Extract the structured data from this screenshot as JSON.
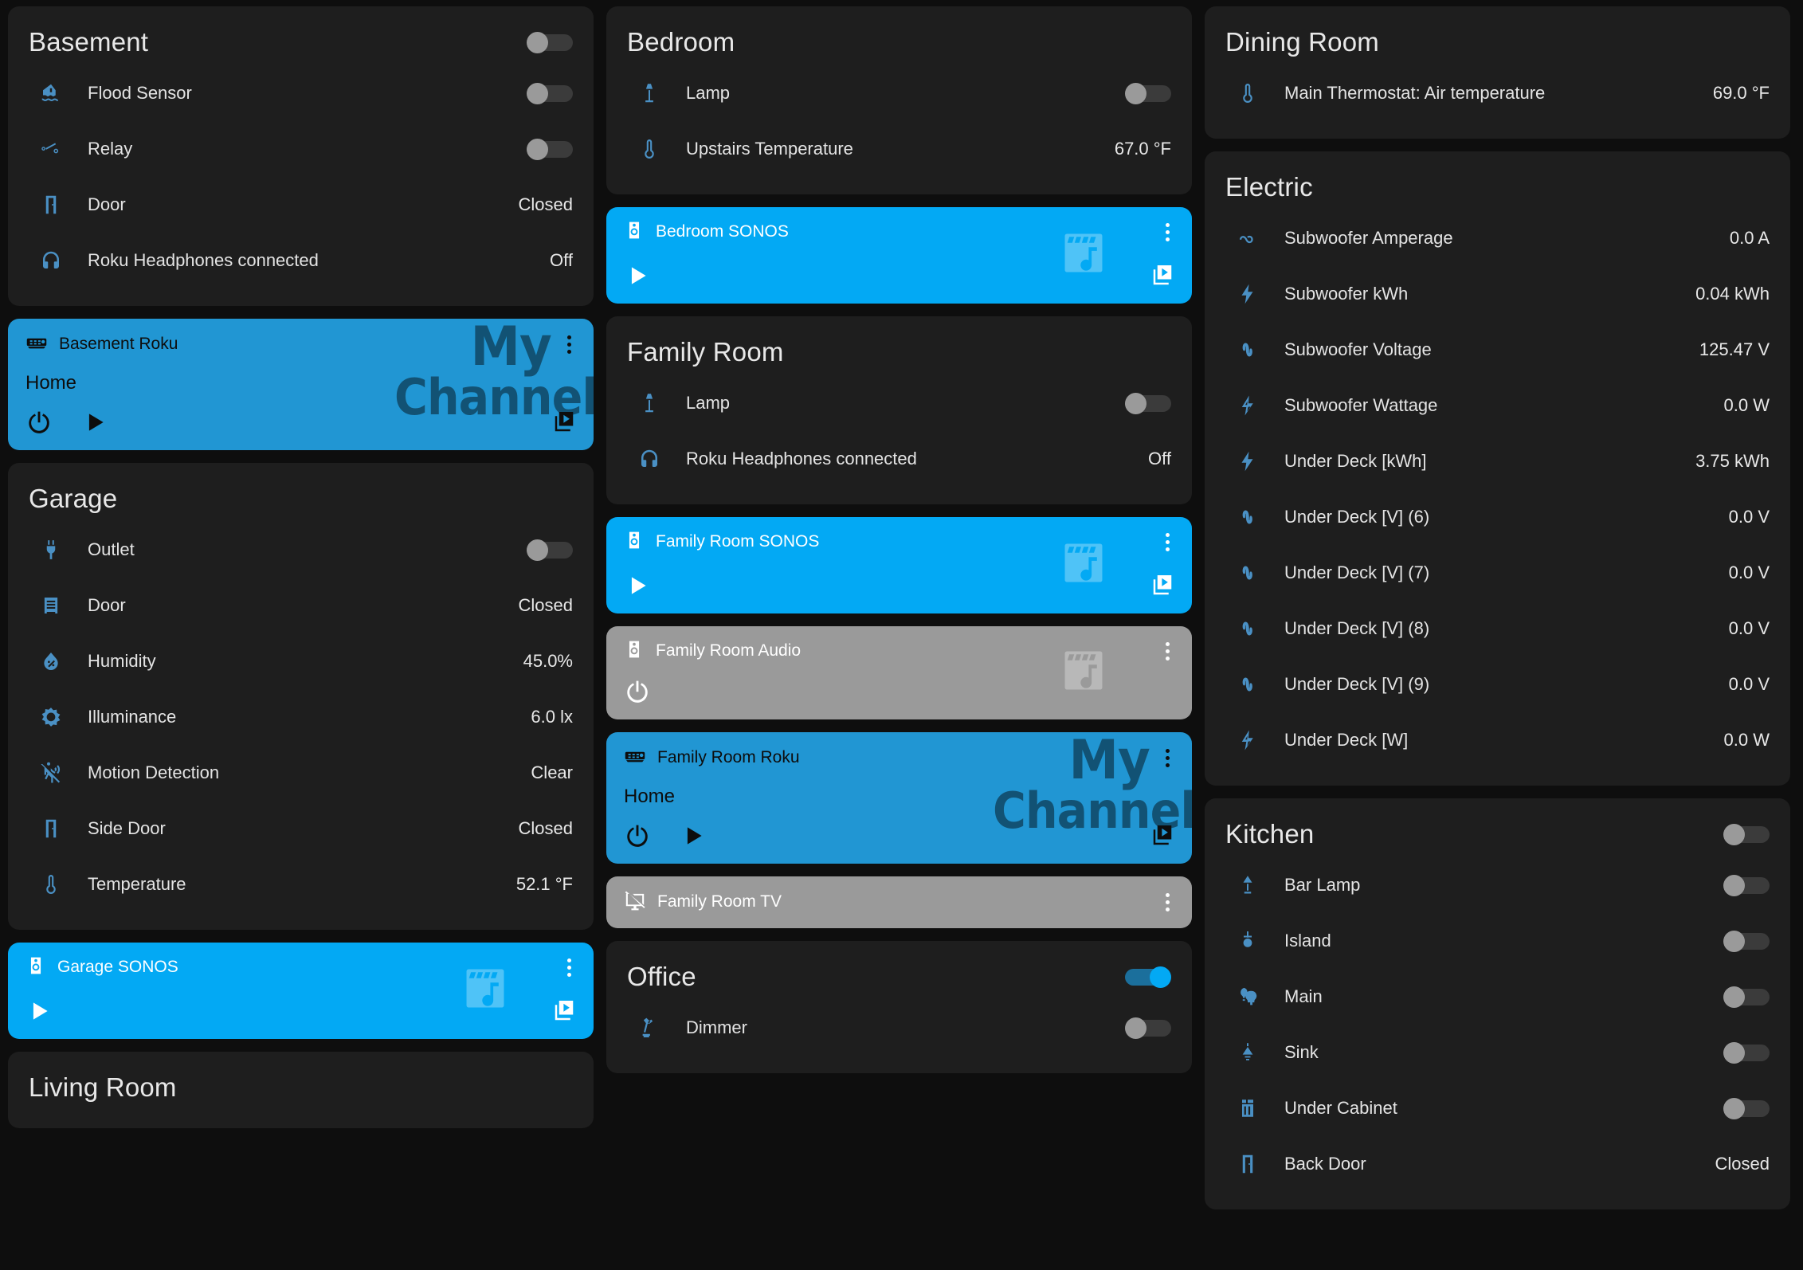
{
  "theme": {
    "page_bg": "#0e0e0e",
    "card_bg": "#1e1e1e",
    "accent_blue": "#03a9f4",
    "roku_blue": "#2196d3",
    "off_gray": "#9a9a9a",
    "icon_blue": "#4a90c4"
  },
  "columns": [
    {
      "cards": [
        {
          "kind": "entities",
          "title": "Basement",
          "header_toggle": "off",
          "rows": [
            {
              "icon": "flood-sensor-icon",
              "label": "Flood Sensor",
              "control": "toggle",
              "state": "off"
            },
            {
              "icon": "relay-switch-icon",
              "label": "Relay",
              "control": "toggle",
              "state": "off"
            },
            {
              "icon": "door-icon",
              "label": "Door",
              "control": "value",
              "value": "Closed"
            },
            {
              "icon": "headphones-icon",
              "label": "Roku Headphones connected",
              "control": "value",
              "value": "Off"
            }
          ]
        },
        {
          "kind": "media",
          "variant": "roku",
          "icon": "roku-remote-icon",
          "name": "Basement Roku",
          "status": "Home",
          "watermark_line1": "My",
          "watermark_line2": "Channel",
          "controls": [
            "power-icon",
            "play-icon"
          ],
          "has_browse": true
        },
        {
          "kind": "entities",
          "title": "Garage",
          "header_toggle": "none",
          "rows": [
            {
              "icon": "power-plug-icon",
              "label": "Outlet",
              "control": "toggle",
              "state": "off"
            },
            {
              "icon": "garage-door-icon",
              "label": "Door",
              "control": "value",
              "value": "Closed"
            },
            {
              "icon": "humidity-icon",
              "label": "Humidity",
              "control": "value",
              "value": "45.0%"
            },
            {
              "icon": "brightness-icon",
              "label": "Illuminance",
              "control": "value",
              "value": "6.0 lx"
            },
            {
              "icon": "motion-off-icon",
              "label": "Motion Detection",
              "control": "value",
              "value": "Clear"
            },
            {
              "icon": "door-icon",
              "label": "Side Door",
              "control": "value",
              "value": "Closed"
            },
            {
              "icon": "thermometer-icon",
              "label": "Temperature",
              "control": "value",
              "value": "52.1 °F"
            }
          ]
        },
        {
          "kind": "media",
          "variant": "sonos",
          "icon": "speaker-icon",
          "name": "Garage SONOS",
          "status": "",
          "controls": [
            "play-icon"
          ],
          "has_browse": true
        },
        {
          "kind": "entities",
          "title": "Living Room",
          "header_toggle": "none",
          "truncated": true,
          "rows": []
        }
      ]
    },
    {
      "cards": [
        {
          "kind": "entities",
          "title": "Bedroom",
          "header_toggle": "none",
          "rows": [
            {
              "icon": "floor-lamp-icon",
              "label": "Lamp",
              "control": "toggle",
              "state": "off"
            },
            {
              "icon": "thermometer-icon",
              "label": "Upstairs Temperature",
              "control": "value",
              "value": "67.0 °F"
            }
          ]
        },
        {
          "kind": "media",
          "variant": "sonos",
          "icon": "speaker-icon",
          "name": "Bedroom SONOS",
          "status": "",
          "controls": [
            "play-icon"
          ],
          "has_browse": true
        },
        {
          "kind": "entities",
          "title": "Family Room",
          "header_toggle": "none",
          "rows": [
            {
              "icon": "floor-lamp-icon",
              "label": "Lamp",
              "control": "toggle",
              "state": "off"
            },
            {
              "icon": "headphones-icon",
              "label": "Roku Headphones connected",
              "control": "value",
              "value": "Off"
            }
          ]
        },
        {
          "kind": "media",
          "variant": "sonos",
          "icon": "speaker-icon",
          "name": "Family Room SONOS",
          "status": "",
          "controls": [
            "play-icon"
          ],
          "has_browse": true
        },
        {
          "kind": "media",
          "variant": "off",
          "icon": "speaker-icon",
          "name": "Family Room Audio",
          "status": "",
          "controls": [
            "power-icon"
          ],
          "has_browse": false
        },
        {
          "kind": "media",
          "variant": "roku",
          "icon": "roku-remote-icon",
          "name": "Family Room Roku",
          "status": "Home",
          "watermark_line1": "My",
          "watermark_line2": "Channel",
          "controls": [
            "power-icon",
            "play-icon"
          ],
          "has_browse": true
        },
        {
          "kind": "media",
          "variant": "tv",
          "icon": "tv-off-icon",
          "name": "Family Room TV",
          "status": "",
          "controls": [],
          "has_browse": false
        },
        {
          "kind": "entities",
          "title": "Office",
          "header_toggle": "on",
          "truncated": true,
          "rows": [
            {
              "icon": "desk-lamp-icon",
              "label": "Dimmer",
              "control": "toggle",
              "state": "off"
            }
          ]
        }
      ]
    },
    {
      "cards": [
        {
          "kind": "entities",
          "title": "Dining Room",
          "header_toggle": "none",
          "rows": [
            {
              "icon": "thermometer-icon",
              "label": "Main Thermostat: Air temperature",
              "control": "value",
              "value": "69.0 °F"
            }
          ]
        },
        {
          "kind": "entities",
          "title": "Electric",
          "header_toggle": "none",
          "rows": [
            {
              "icon": "current-ac-icon",
              "label": "Subwoofer Amperage",
              "control": "value",
              "value": "0.0 A"
            },
            {
              "icon": "lightning-icon",
              "label": "Subwoofer kWh",
              "control": "value",
              "value": "0.04 kWh"
            },
            {
              "icon": "sine-wave-icon",
              "label": "Subwoofer Voltage",
              "control": "value",
              "value": "125.47 V"
            },
            {
              "icon": "flash-outline-icon",
              "label": "Subwoofer Wattage",
              "control": "value",
              "value": "0.0 W"
            },
            {
              "icon": "lightning-icon",
              "label": "Under Deck [kWh]",
              "control": "value",
              "value": "3.75 kWh"
            },
            {
              "icon": "sine-wave-icon",
              "label": "Under Deck [V] (6)",
              "control": "value",
              "value": "0.0 V"
            },
            {
              "icon": "sine-wave-icon",
              "label": "Under Deck [V] (7)",
              "control": "value",
              "value": "0.0 V"
            },
            {
              "icon": "sine-wave-icon",
              "label": "Under Deck [V] (8)",
              "control": "value",
              "value": "0.0 V"
            },
            {
              "icon": "sine-wave-icon",
              "label": "Under Deck [V] (9)",
              "control": "value",
              "value": "0.0 V"
            },
            {
              "icon": "flash-outline-icon",
              "label": "Under Deck [W]",
              "control": "value",
              "value": "0.0 W"
            }
          ]
        },
        {
          "kind": "entities",
          "title": "Kitchen",
          "header_toggle": "off",
          "truncated": true,
          "rows": [
            {
              "icon": "table-lamp-icon",
              "label": "Bar Lamp",
              "control": "toggle",
              "state": "off"
            },
            {
              "icon": "pendant-light-icon",
              "label": "Island",
              "control": "toggle",
              "state": "off"
            },
            {
              "icon": "bulb-group-icon",
              "label": "Main",
              "control": "toggle",
              "state": "off"
            },
            {
              "icon": "ceiling-light-icon",
              "label": "Sink",
              "control": "toggle",
              "state": "off"
            },
            {
              "icon": "under-cabinet-icon",
              "label": "Under Cabinet",
              "control": "toggle",
              "state": "off"
            },
            {
              "icon": "door-icon",
              "label": "Back Door",
              "control": "value",
              "value": "Closed"
            }
          ]
        }
      ]
    }
  ]
}
